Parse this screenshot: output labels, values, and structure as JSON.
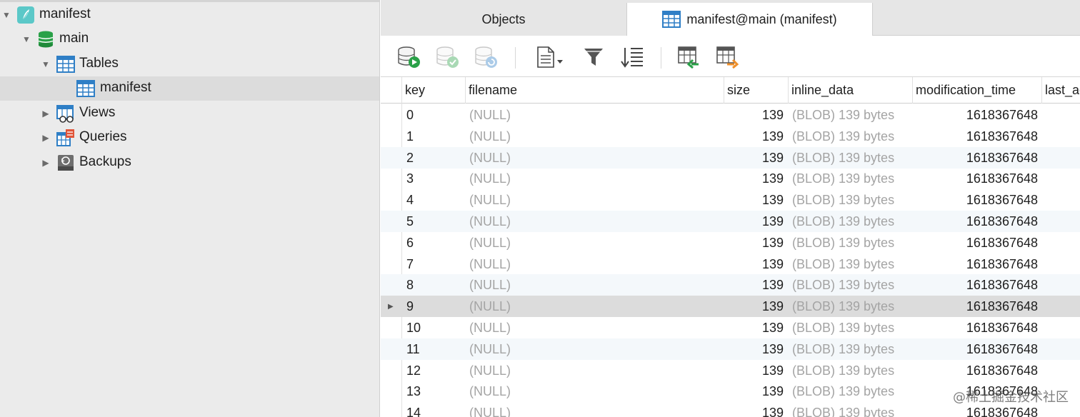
{
  "sidebar": {
    "items": [
      {
        "label": "manifest",
        "level": "root",
        "expanded": true,
        "icon": "sqlite-feather-icon"
      },
      {
        "label": "main",
        "level": "schema",
        "expanded": true,
        "icon": "database-icon"
      },
      {
        "label": "Tables",
        "level": "group",
        "expanded": true,
        "icon": "table-group-icon"
      },
      {
        "label": "manifest",
        "level": "item",
        "selected": true,
        "icon": "table-icon"
      },
      {
        "label": "Views",
        "level": "group",
        "expanded": false,
        "icon": "view-icon"
      },
      {
        "label": "Queries",
        "level": "group",
        "expanded": false,
        "icon": "query-icon"
      },
      {
        "label": "Backups",
        "level": "group",
        "expanded": false,
        "icon": "backup-icon"
      }
    ]
  },
  "tabs": {
    "objects_label": "Objects",
    "active_label": "manifest@main (manifest)"
  },
  "toolbar": {
    "buttons": [
      {
        "name": "begin-transaction",
        "icon": "db-play-icon",
        "enabled": true
      },
      {
        "name": "commit",
        "icon": "db-check-icon",
        "enabled": false
      },
      {
        "name": "rollback",
        "icon": "db-revert-icon",
        "enabled": false
      },
      {
        "name": "text-view",
        "icon": "document-dropdown-icon",
        "enabled": true
      },
      {
        "name": "filter",
        "icon": "filter-icon",
        "enabled": true
      },
      {
        "name": "sort",
        "icon": "sort-icon",
        "enabled": true
      },
      {
        "name": "import",
        "icon": "table-import-icon",
        "enabled": true
      },
      {
        "name": "export",
        "icon": "table-export-icon",
        "enabled": true
      }
    ]
  },
  "grid": {
    "columns": [
      "key",
      "filename",
      "size",
      "inline_data",
      "modification_time",
      "last_ac"
    ],
    "rows": [
      {
        "key": "0",
        "filename": "(NULL)",
        "size": "139",
        "inline_data": "(BLOB) 139 bytes",
        "modification_time": "1618367648"
      },
      {
        "key": "1",
        "filename": "(NULL)",
        "size": "139",
        "inline_data": "(BLOB) 139 bytes",
        "modification_time": "1618367648"
      },
      {
        "key": "2",
        "filename": "(NULL)",
        "size": "139",
        "inline_data": "(BLOB) 139 bytes",
        "modification_time": "1618367648"
      },
      {
        "key": "3",
        "filename": "(NULL)",
        "size": "139",
        "inline_data": "(BLOB) 139 bytes",
        "modification_time": "1618367648"
      },
      {
        "key": "4",
        "filename": "(NULL)",
        "size": "139",
        "inline_data": "(BLOB) 139 bytes",
        "modification_time": "1618367648"
      },
      {
        "key": "5",
        "filename": "(NULL)",
        "size": "139",
        "inline_data": "(BLOB) 139 bytes",
        "modification_time": "1618367648"
      },
      {
        "key": "6",
        "filename": "(NULL)",
        "size": "139",
        "inline_data": "(BLOB) 139 bytes",
        "modification_time": "1618367648"
      },
      {
        "key": "7",
        "filename": "(NULL)",
        "size": "139",
        "inline_data": "(BLOB) 139 bytes",
        "modification_time": "1618367648"
      },
      {
        "key": "8",
        "filename": "(NULL)",
        "size": "139",
        "inline_data": "(BLOB) 139 bytes",
        "modification_time": "1618367648"
      },
      {
        "key": "9",
        "filename": "(NULL)",
        "size": "139",
        "inline_data": "(BLOB) 139 bytes",
        "modification_time": "1618367648",
        "current": true
      },
      {
        "key": "10",
        "filename": "(NULL)",
        "size": "139",
        "inline_data": "(BLOB) 139 bytes",
        "modification_time": "1618367648"
      },
      {
        "key": "11",
        "filename": "(NULL)",
        "size": "139",
        "inline_data": "(BLOB) 139 bytes",
        "modification_time": "1618367648"
      },
      {
        "key": "12",
        "filename": "(NULL)",
        "size": "139",
        "inline_data": "(BLOB) 139 bytes",
        "modification_time": "1618367648"
      },
      {
        "key": "13",
        "filename": "(NULL)",
        "size": "139",
        "inline_data": "(BLOB) 139 bytes",
        "modification_time": "1618367648"
      },
      {
        "key": "14",
        "filename": "(NULL)",
        "size": "139",
        "inline_data": "(BLOB) 139 bytes",
        "modification_time": "1618367648"
      }
    ]
  },
  "watermark": "@稀土掘金技术社区",
  "colors": {
    "sidebar_bg": "#ebebeb",
    "selected_row": "#dcdcdc",
    "alt_row": "#f4f8fb",
    "null_text": "#a4a4a4",
    "accent_blue": "#2f7fc6",
    "db_green": "#2aa148"
  }
}
